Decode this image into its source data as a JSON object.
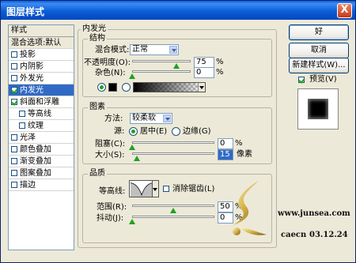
{
  "window": {
    "title": "图层样式",
    "close_glyph": "X"
  },
  "style_list": {
    "header": "样式",
    "items": [
      {
        "label": "混合选项:默认",
        "checkbox": false,
        "checked": false,
        "indent": false,
        "selected": false,
        "plain": true
      },
      {
        "label": "投影",
        "checkbox": true,
        "checked": false,
        "indent": false,
        "selected": false
      },
      {
        "label": "内阴影",
        "checkbox": true,
        "checked": false,
        "indent": false,
        "selected": false
      },
      {
        "label": "外发光",
        "checkbox": true,
        "checked": false,
        "indent": false,
        "selected": false
      },
      {
        "label": "内发光",
        "checkbox": true,
        "checked": true,
        "indent": false,
        "selected": true
      },
      {
        "label": "斜面和浮雕",
        "checkbox": true,
        "checked": true,
        "indent": false,
        "selected": false
      },
      {
        "label": "等高线",
        "checkbox": true,
        "checked": false,
        "indent": true,
        "selected": false
      },
      {
        "label": "纹理",
        "checkbox": true,
        "checked": false,
        "indent": true,
        "selected": false
      },
      {
        "label": "光泽",
        "checkbox": true,
        "checked": false,
        "indent": false,
        "selected": false
      },
      {
        "label": "颜色叠加",
        "checkbox": true,
        "checked": false,
        "indent": false,
        "selected": false
      },
      {
        "label": "渐变叠加",
        "checkbox": true,
        "checked": false,
        "indent": false,
        "selected": false
      },
      {
        "label": "图案叠加",
        "checkbox": true,
        "checked": false,
        "indent": false,
        "selected": false
      },
      {
        "label": "描边",
        "checkbox": true,
        "checked": false,
        "indent": false,
        "selected": false
      }
    ]
  },
  "panel": {
    "title": "内发光",
    "structure": {
      "label": "结构",
      "blend_mode_label": "混合模式:",
      "blend_mode_value": "正常",
      "opacity_label": "不透明度(O):",
      "opacity_value": "75",
      "opacity_level": 0.75,
      "noise_label": "杂色(N):",
      "noise_value": "0",
      "noise_level": 0,
      "unit": "%"
    },
    "elements": {
      "label": "图素",
      "method_label": "方法:",
      "method_value": "较柔软",
      "source_label": "源:",
      "source_center": "居中(E)",
      "source_edge": "边缘(G)",
      "choke_label": "阻塞(C):",
      "choke_value": "0",
      "choke_level": 0,
      "size_label": "大小(S):",
      "size_value": "15",
      "size_unit": "像素",
      "size_level": 0.06,
      "unit": "%"
    },
    "quality": {
      "label": "品质",
      "contour_label": "等高线:",
      "antialias_label": "消除锯齿(L)",
      "range_label": "范围(R):",
      "range_value": "50",
      "range_level": 0.5,
      "jitter_label": "抖动(J):",
      "jitter_value": "0",
      "jitter_level": 0,
      "unit": "%"
    }
  },
  "buttons": {
    "ok": "好",
    "cancel": "取消",
    "new_style": "新建样式(W)...",
    "preview": "预览(V)"
  },
  "watermark": {
    "site": "www.junsea.com",
    "author": "caecn",
    "date": "03.12.24"
  },
  "colors": {
    "glow": "#000000",
    "accent": "#316AC5",
    "title_bar": "#0A5ED7"
  }
}
